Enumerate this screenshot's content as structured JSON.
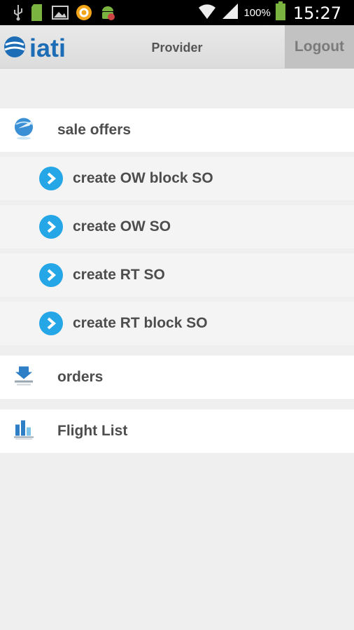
{
  "status_bar": {
    "left_icons": [
      "usb-icon",
      "sd-card-icon",
      "image-icon",
      "app-notification-icon",
      "android-debug-icon"
    ],
    "battery_percent": "100%",
    "time": "15:27"
  },
  "header": {
    "logo_text": "iati",
    "title": "Provider",
    "logout_label": "Logout"
  },
  "menu": {
    "sale_offers": {
      "label": "sale offers",
      "icon": "globe-plane-icon"
    },
    "sub_items": [
      {
        "label": "create OW block SO"
      },
      {
        "label": "create OW SO"
      },
      {
        "label": "create RT SO"
      },
      {
        "label": "create RT block SO"
      }
    ],
    "orders": {
      "label": "orders",
      "icon": "download-tray-icon"
    },
    "flight_list": {
      "label": "Flight List",
      "icon": "bar-chart-icon"
    }
  },
  "colors": {
    "accent": "#25a6e6",
    "brand": "#1d6db6",
    "background": "#efefef"
  }
}
